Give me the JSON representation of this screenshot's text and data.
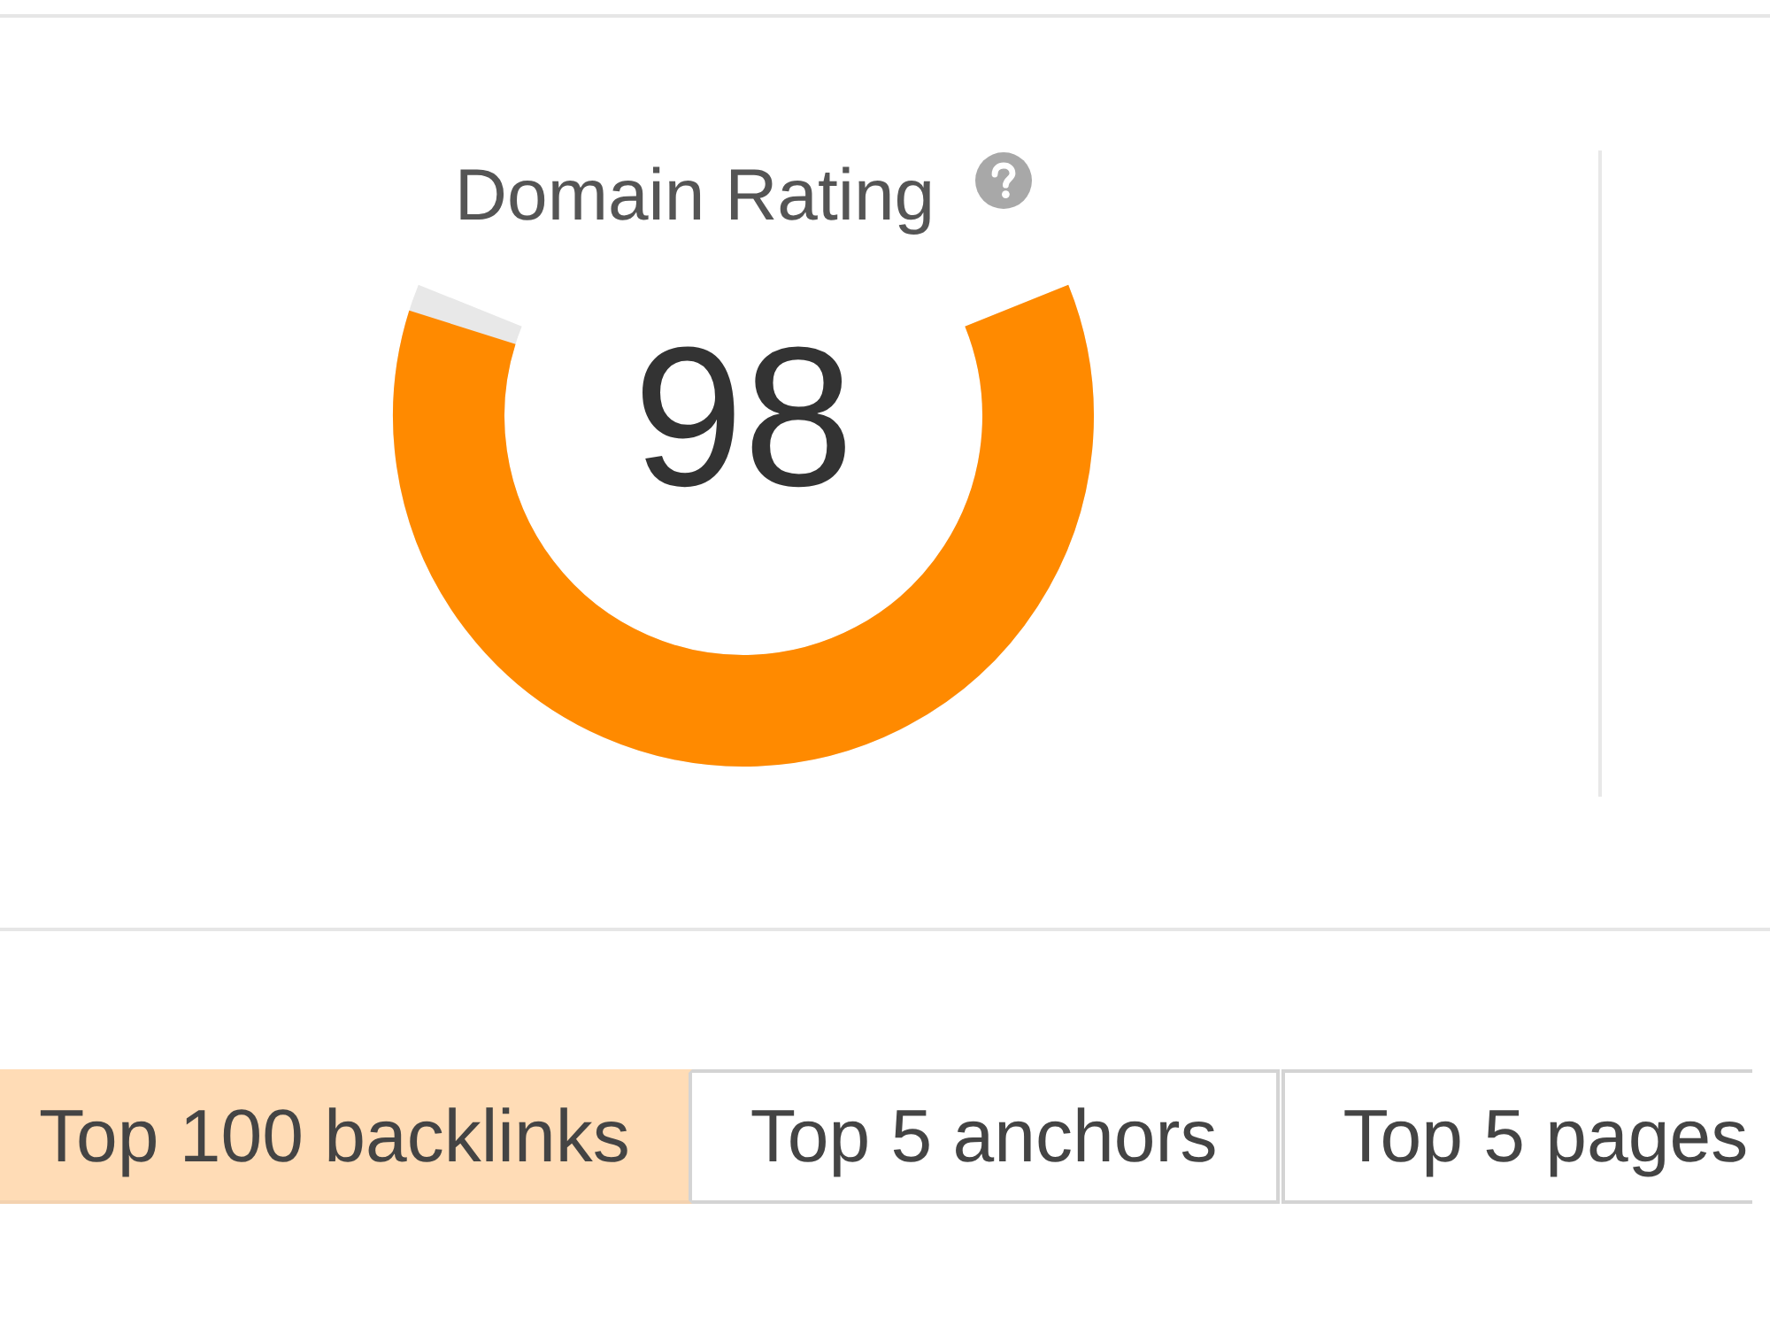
{
  "metric": {
    "title": "Domain Rating",
    "value": "98",
    "level": 0.98
  },
  "tabs": [
    {
      "label": "Top 100 backlinks",
      "selected": true
    },
    {
      "label": "Top 5 anchors",
      "selected": false
    },
    {
      "label": "Top 5 pages",
      "selected": false
    }
  ]
}
